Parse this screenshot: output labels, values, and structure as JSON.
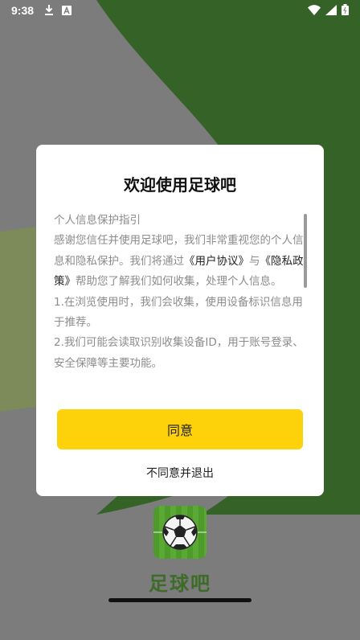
{
  "status_bar": {
    "time": "9:38",
    "left_icons": [
      "download-icon",
      "a-badge-icon"
    ],
    "right_icons": [
      "wifi-icon",
      "signal-icon",
      "battery-icon"
    ]
  },
  "dialog": {
    "title": "欢迎使用足球吧",
    "body": {
      "heading": "个人信息保护指引",
      "intro_before": "感谢您信任并使用足球吧，我们非常重视您的个人信息和隐私保护。我们将通过",
      "link_user_agreement": "《用户协议》",
      "and": "与",
      "link_privacy_policy": "《隐私政策》",
      "intro_after": "帮助您了解我们如何收集，处理个人信息。",
      "item1": "1.在浏览使用时，我们会收集，使用设备标识信息用于推荐。",
      "item2": "2.我们可能会读取识别收集设备ID，用于账号登录、安全保障等主要功能。"
    },
    "agree_label": "同意",
    "disagree_label": "不同意并退出"
  },
  "app": {
    "name": "足球吧",
    "logo_icon": "soccer-ball-icon"
  },
  "colors": {
    "accent": "#fdd20b",
    "brand_green": "#3d6b28",
    "overlay": "#7c7c7c"
  }
}
